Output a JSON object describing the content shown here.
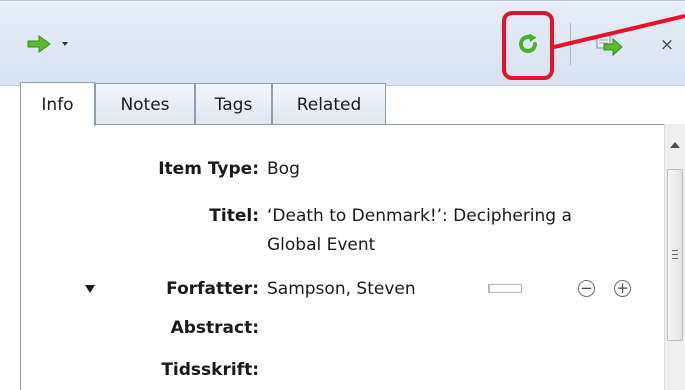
{
  "toolbar": {
    "locate_icon": "green-arrow-icon",
    "locate_menu_icon": "caret-down-icon",
    "sync_icon": "green-refresh-icon",
    "goto_icon": "go-to-item-icon",
    "close_label": "×"
  },
  "annotation": {
    "highlight_color": "#e8102c"
  },
  "tabs": [
    {
      "label": "Info",
      "active": true
    },
    {
      "label": "Notes",
      "active": false
    },
    {
      "label": "Tags",
      "active": false
    },
    {
      "label": "Related",
      "active": false
    }
  ],
  "fields": {
    "item_type": {
      "label": "Item Type:",
      "value": "Bog"
    },
    "title": {
      "label": "Titel:",
      "value_line1": "‘Death to Denmark!’: Deciphering a",
      "value_line2": "Global Event"
    },
    "author": {
      "label": "Forfatter:",
      "value": "Sampson, Steven",
      "remove_symbol": "−",
      "add_symbol": "+"
    },
    "abstract": {
      "label": "Abstract:",
      "value": ""
    },
    "journal": {
      "label": "Tidsskrift:",
      "value": ""
    }
  },
  "colors": {
    "toolbar_bg": "#dde7f2",
    "icon_green": "#4caf2b",
    "accent_red": "#e8102c"
  }
}
